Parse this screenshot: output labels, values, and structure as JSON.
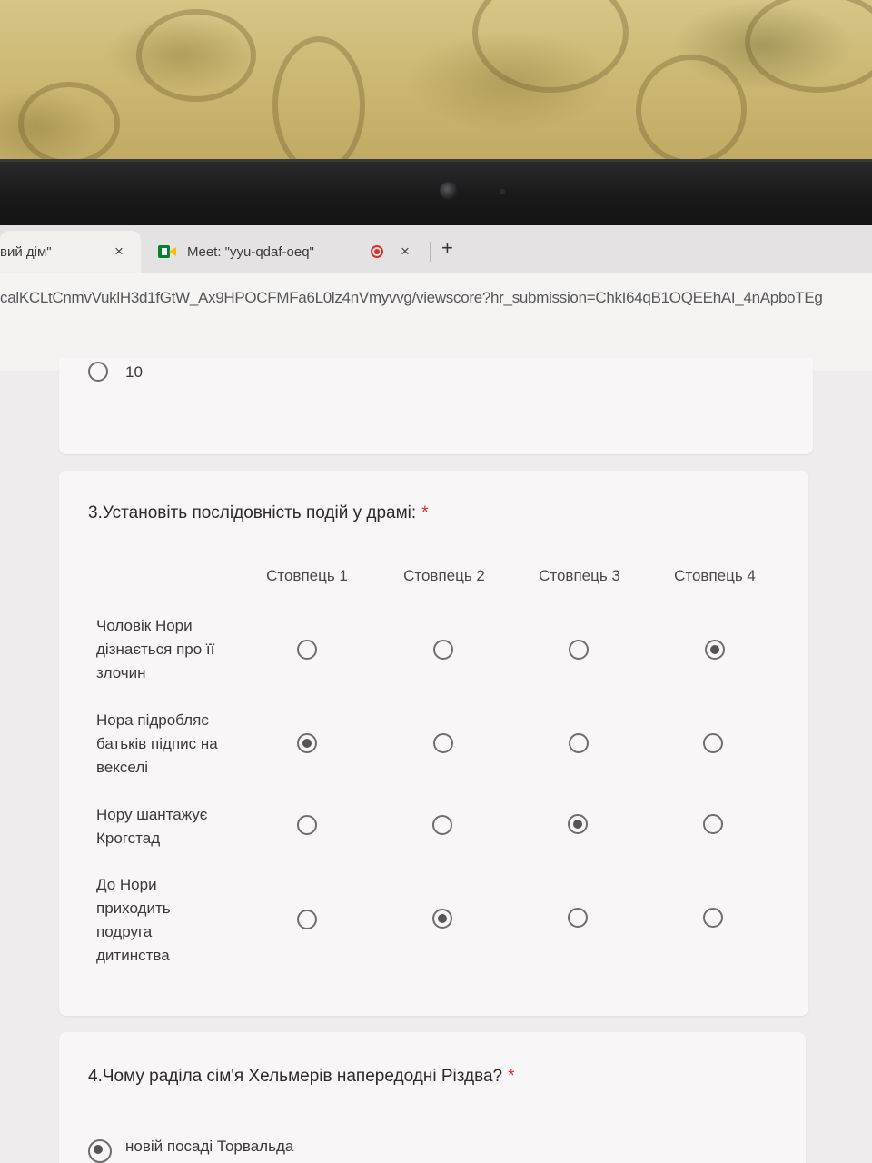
{
  "browser": {
    "tabs": [
      {
        "title": "вий дім\"",
        "close": "×"
      },
      {
        "title": "Meet: \"yyu-qdaf-oeq\"",
        "close": "×"
      }
    ],
    "new_tab": "+",
    "url": "calKCLtCnmvVuklH3d1fGtW_Ax9HPOCFMFa6L0lz4nVmyvvg/viewscore?hr_submission=ChkI64qB1OQEEhAI_4nApboTEg"
  },
  "previous_question": {
    "last_option_label": "10"
  },
  "question3": {
    "title": "3.Установіть послідовність подій у драмі:",
    "required_mark": "*",
    "columns": [
      "Стовпець 1",
      "Стовпець 2",
      "Стовпець 3",
      "Стовпець 4"
    ],
    "rows": [
      {
        "label": "Чоловік Нори дізнається про її злочин",
        "selected_column": 4
      },
      {
        "label": "Нора підробляє батьків підпис на векселі",
        "selected_column": 1
      },
      {
        "label": "Нору шантажує Крогстад",
        "selected_column": 3
      },
      {
        "label": "До Нори приходить подруга дитинства",
        "selected_column": 2
      }
    ]
  },
  "question4": {
    "title": "4.Чому раділа сім'я Хельмерів напередодні Різдва?",
    "required_mark": "*",
    "visible_option_label": "новій посаді Торвальда",
    "visible_option_selected": true
  }
}
